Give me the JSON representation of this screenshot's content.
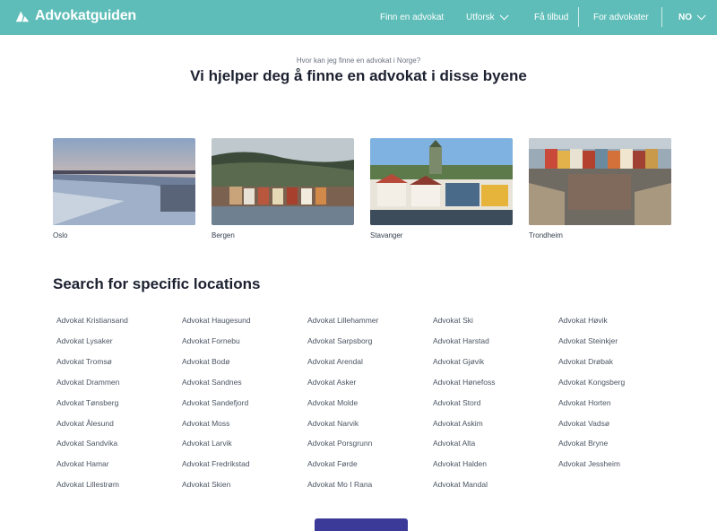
{
  "header": {
    "brand": "Advokatguiden",
    "brand_icon": "advokatguiden-logo-icon",
    "bg_color": "#5ebdb8",
    "nav": {
      "find_lawyer": "Finn en advokat",
      "explore": "Utforsk",
      "get_offer": "Få tilbud",
      "for_lawyers": "For advokater",
      "language": "NO"
    }
  },
  "hero": {
    "subtitle": "Hvor kan jeg finne en advokat i Norge?",
    "title": "Vi hjelper deg å finne en advokat i disse byene"
  },
  "cities": [
    {
      "name": "Oslo"
    },
    {
      "name": "Bergen"
    },
    {
      "name": "Stavanger"
    },
    {
      "name": "Trondheim"
    }
  ],
  "locations_section": {
    "title": "Search for specific locations",
    "columns": [
      [
        "Advokat Kristiansand",
        "Advokat Lysaker",
        "Advokat Tromsø",
        "Advokat Drammen",
        "Advokat Tønsberg",
        "Advokat Ålesund",
        "Advokat Sandvika",
        "Advokat Hamar",
        "Advokat Lillestrøm"
      ],
      [
        "Advokat Haugesund",
        "Advokat Fornebu",
        "Advokat Bodø",
        "Advokat Sandnes",
        "Advokat Sandefjord",
        "Advokat Moss",
        "Advokat Larvik",
        "Advokat Fredrikstad",
        "Advokat Skien"
      ],
      [
        "Advokat Lillehammer",
        "Advokat Sarpsborg",
        "Advokat Arendal",
        "Advokat Asker",
        "Advokat Molde",
        "Advokat Narvik",
        "Advokat Porsgrunn",
        "Advokat Førde",
        "Advokat Mo I Rana"
      ],
      [
        "Advokat Ski",
        "Advokat Harstad",
        "Advokat Gjøvik",
        "Advokat Hønefoss",
        "Advokat Stord",
        "Advokat Askim",
        "Advokat Alta",
        "Advokat Halden",
        "Advokat Mandal"
      ],
      [
        "Advokat Høvik",
        "Advokat Steinkjer",
        "Advokat Drøbak",
        "Advokat Kongsberg",
        "Advokat Horten",
        "Advokat Vadsø",
        "Advokat Bryne",
        "Advokat Jessheim"
      ]
    ]
  },
  "colors": {
    "accent": "#5ebdb8",
    "cta": "#3b3a99"
  }
}
